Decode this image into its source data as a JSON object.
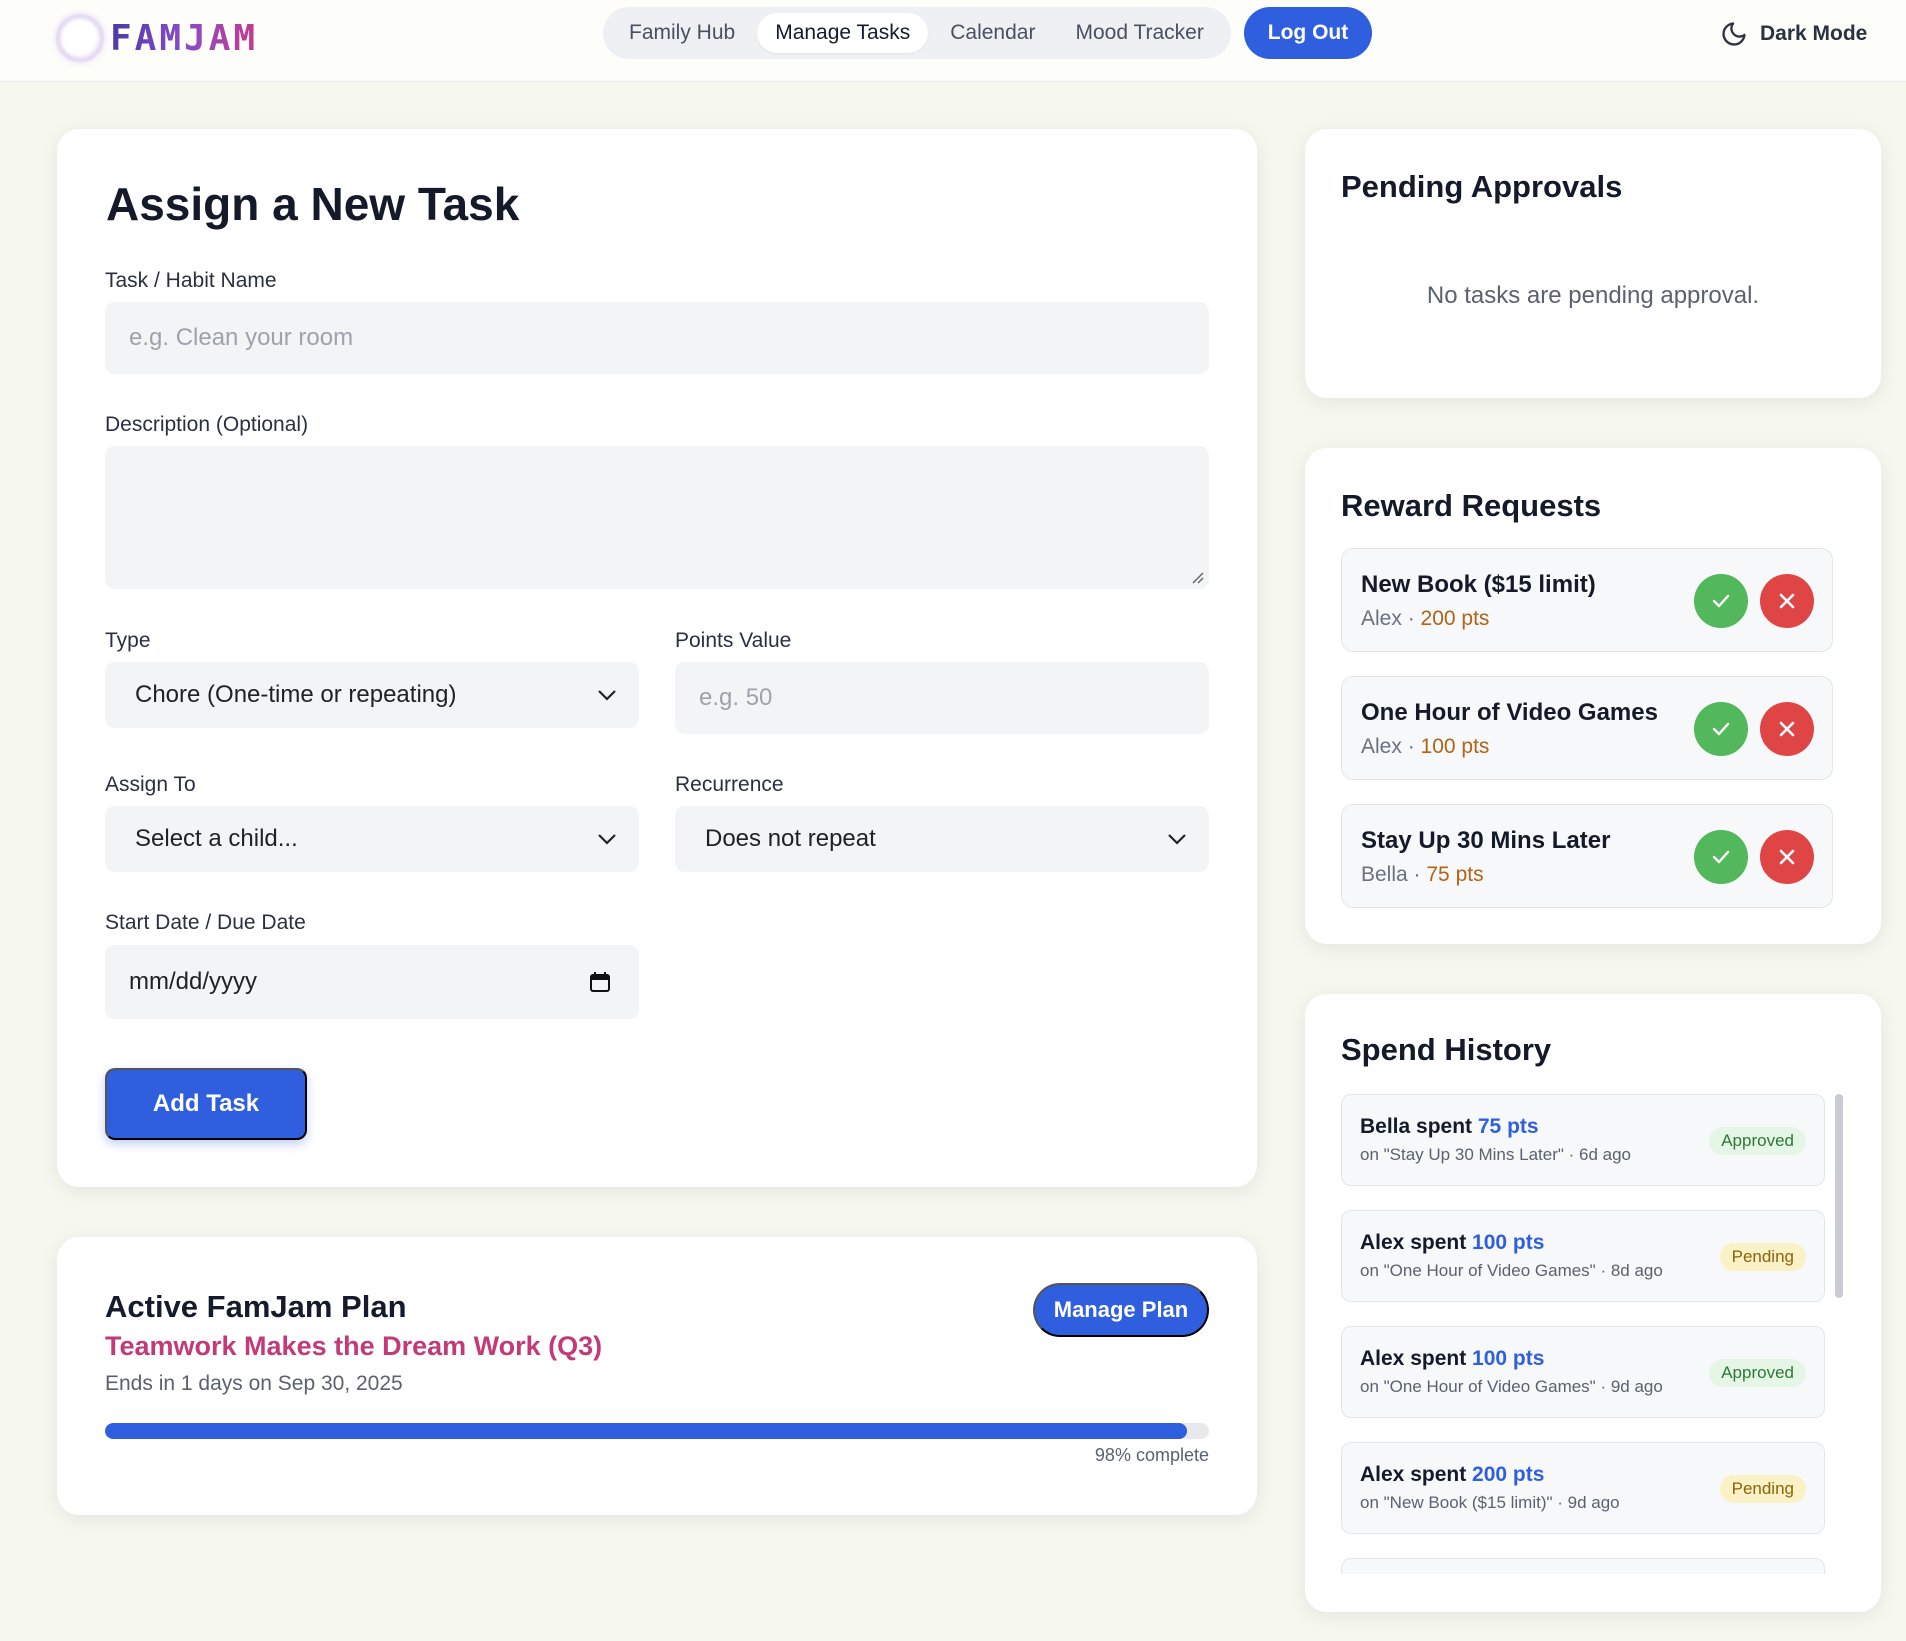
{
  "header": {
    "logo_text": "FAMJAM",
    "nav": [
      {
        "label": "Family Hub"
      },
      {
        "label": "Manage Tasks"
      },
      {
        "label": "Calendar"
      },
      {
        "label": "Mood Tracker"
      }
    ],
    "logout_label": "Log Out",
    "dark_mode_label": "Dark Mode"
  },
  "form": {
    "title": "Assign a New Task",
    "task_name_label": "Task / Habit Name",
    "task_name_placeholder": "e.g. Clean your room",
    "description_label": "Description (Optional)",
    "type_label": "Type",
    "type_value": "Chore (One-time or repeating)",
    "points_label": "Points Value",
    "points_placeholder": "e.g. 50",
    "assign_label": "Assign To",
    "assign_value": "Select a child...",
    "recurrence_label": "Recurrence",
    "recurrence_value": "Does not repeat",
    "date_label": "Start Date / Due Date",
    "date_value": "mm/dd/yyyy",
    "submit_label": "Add Task"
  },
  "plan": {
    "title": "Active FamJam Plan",
    "name": "Teamwork Makes the Dream Work (Q3)",
    "ends": "Ends in 1 days on Sep 30, 2025",
    "manage_label": "Manage Plan",
    "progress_percent": 98,
    "progress_label": "98% complete"
  },
  "pending": {
    "title": "Pending Approvals",
    "empty_message": "No tasks are pending approval."
  },
  "rewards": {
    "title": "Reward Requests",
    "items": [
      {
        "name": "New Book ($15 limit)",
        "child": "Alex",
        "sep": " · ",
        "points": "200 pts"
      },
      {
        "name": "One Hour of Video Games",
        "child": "Alex",
        "sep": " · ",
        "points": "100 pts"
      },
      {
        "name": "Stay Up 30 Mins Later",
        "child": "Bella",
        "sep": " · ",
        "points": "75 pts"
      }
    ]
  },
  "spend": {
    "title": "Spend History",
    "items": [
      {
        "who": "Bella spent ",
        "points": "75 pts",
        "detail": "on \"Stay Up 30 Mins Later\" · 6d ago",
        "status": "Approved"
      },
      {
        "who": "Alex spent ",
        "points": "100 pts",
        "detail": "on \"One Hour of Video Games\" · 8d ago",
        "status": "Pending"
      },
      {
        "who": "Alex spent ",
        "points": "100 pts",
        "detail": "on \"One Hour of Video Games\" · 9d ago",
        "status": "Approved"
      },
      {
        "who": "Alex spent ",
        "points": "200 pts",
        "detail": "on \"New Book ($15 limit)\" · 9d ago",
        "status": "Pending"
      }
    ]
  },
  "colors": {
    "accent": "#2f5fde",
    "plan_name": "#c23a78",
    "approve": "#53b85c",
    "deny": "#e04545",
    "points": "#b06418"
  },
  "icons": {
    "dark_mode": "moon-icon",
    "select": "chevron-down-icon",
    "date": "calendar-icon",
    "approve": "check-icon",
    "deny": "close-icon"
  }
}
